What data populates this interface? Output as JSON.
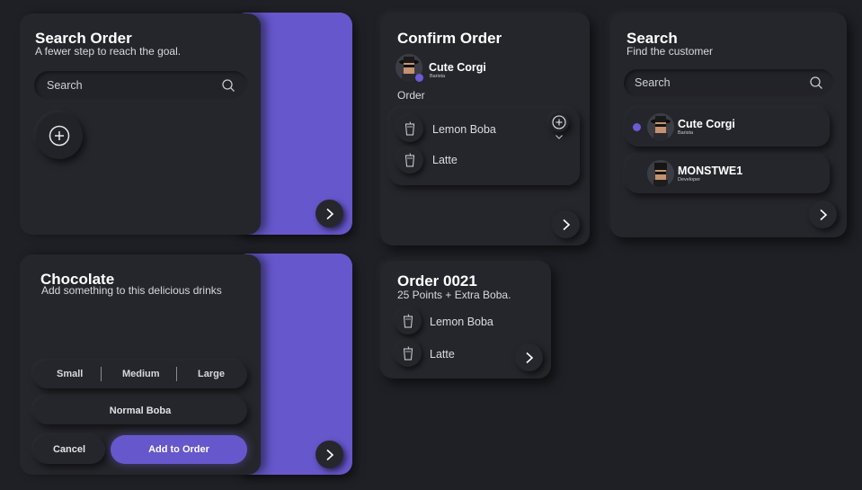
{
  "search_order": {
    "title": "Search Order",
    "subtitle": "A fewer step to reach the goal.",
    "search_placeholder": "Search"
  },
  "confirm_order": {
    "title": "Confirm Order",
    "user_name": "Cute Corgi",
    "user_role": "Barista",
    "section_label": "Order",
    "items": [
      {
        "label": "Lemon Boba"
      },
      {
        "label": "Latte"
      }
    ]
  },
  "search_customer": {
    "title": "Search",
    "subtitle": "Find the customer",
    "search_placeholder": "Search",
    "customers": [
      {
        "name": "Cute Corgi",
        "role": "Barista",
        "selected": true
      },
      {
        "name": "MONSTWE1",
        "role": "Developer",
        "selected": false
      }
    ]
  },
  "chocolate": {
    "title": "Chocolate",
    "subtitle": "Add something to this delicious drinks",
    "sizes": [
      "Small",
      "Medium",
      "Large"
    ],
    "topping": "Normal Boba",
    "cancel_label": "Cancel",
    "add_label": "Add to Order"
  },
  "order_summary": {
    "title": "Order 0021",
    "subtitle": "25 Points + Extra Boba.",
    "items": [
      {
        "label": "Lemon Boba"
      },
      {
        "label": "Latte"
      }
    ]
  },
  "colors": {
    "background": "#1f2025",
    "card": "#25262b",
    "accent": "#6657cc"
  }
}
